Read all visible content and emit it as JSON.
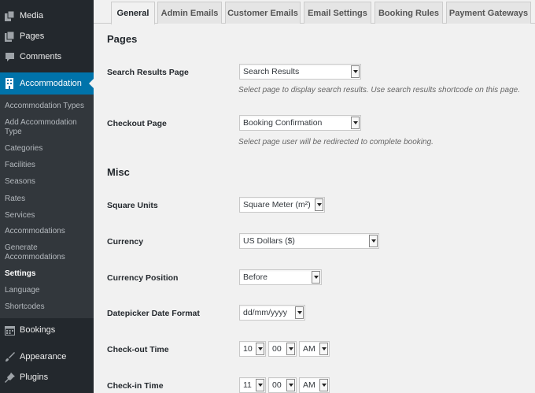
{
  "sidebar": {
    "media": "Media",
    "pages": "Pages",
    "comments": "Comments",
    "accommodation": "Accommodation",
    "submenu": [
      "Accommodation Types",
      "Add Accommodation Type",
      "Categories",
      "Facilities",
      "Seasons",
      "Rates",
      "Services",
      "Accommodations",
      "Generate Accommodations",
      "Settings",
      "Language",
      "Shortcodes"
    ],
    "current_submenu": "Settings",
    "bookings": "Bookings",
    "appearance": "Appearance",
    "plugins": "Plugins"
  },
  "tabs": [
    "General",
    "Admin Emails",
    "Customer Emails",
    "Email Settings",
    "Booking Rules",
    "Payment Gateways"
  ],
  "active_tab": "General",
  "pages_section": {
    "title": "Pages",
    "search_results_label": "Search Results Page",
    "search_results_value": "Search Results",
    "search_results_desc": "Select page to display search results. Use search results shortcode on this page.",
    "checkout_label": "Checkout Page",
    "checkout_value": "Booking Confirmation",
    "checkout_desc": "Select page user will be redirected to complete booking."
  },
  "misc_section": {
    "title": "Misc",
    "square_units_label": "Square Units",
    "square_units_value": "Square Meter (m²)",
    "currency_label": "Currency",
    "currency_value": "US Dollars ($)",
    "currency_position_label": "Currency Position",
    "currency_position_value": "Before",
    "date_format_label": "Datepicker Date Format",
    "date_format_value": "dd/mm/yyyy",
    "checkout_time_label": "Check-out Time",
    "checkout_time_hour": "10",
    "checkout_time_minute": "00",
    "checkout_time_ampm": "AM",
    "checkin_time_label": "Check-in Time",
    "checkin_time_hour": "11",
    "checkin_time_minute": "00",
    "checkin_time_ampm": "AM"
  },
  "colors": {
    "sidebar_bg": "#23282d",
    "submenu_bg": "#32373c",
    "accent": "#0073aa"
  },
  "icons": {
    "media": "media-icon",
    "pages": "pages-icon",
    "comments": "comments-icon",
    "accommodation": "building-icon",
    "bookings": "calendar-icon",
    "appearance": "paintbrush-icon",
    "plugins": "plug-icon"
  }
}
